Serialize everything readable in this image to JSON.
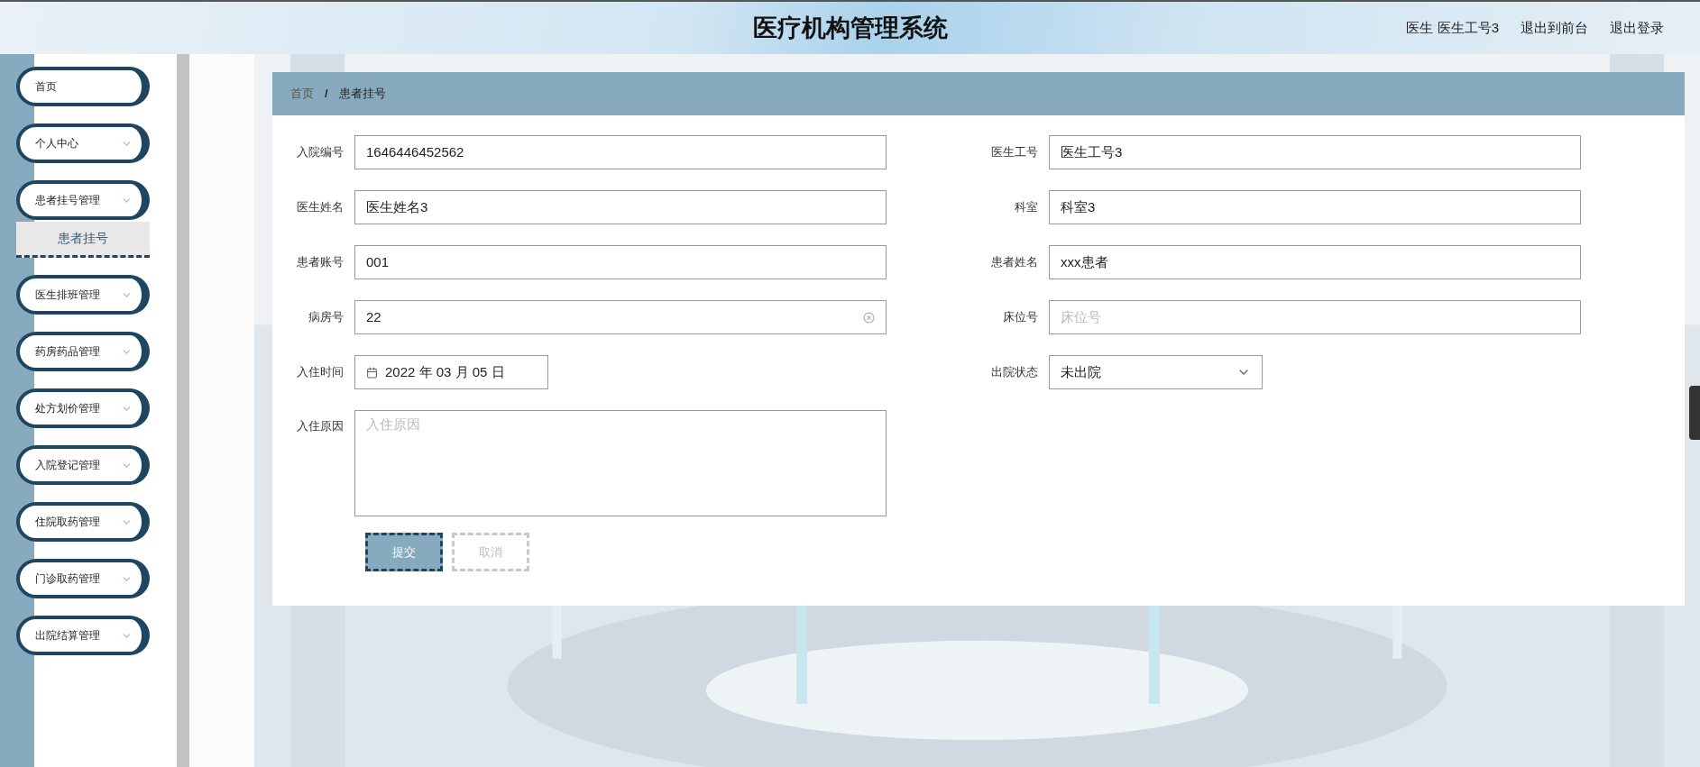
{
  "header": {
    "title": "医疗机构管理系统",
    "user": "医生 医生工号3",
    "links": [
      "退出到前台",
      "退出登录"
    ]
  },
  "sidebar": {
    "items": [
      {
        "label": "首页",
        "kind": "link"
      },
      {
        "label": "个人中心",
        "kind": "menu"
      },
      {
        "label": "患者挂号管理",
        "kind": "menu",
        "children": [
          {
            "label": "患者挂号",
            "selected": true
          }
        ]
      },
      {
        "label": "医生排班管理",
        "kind": "menu"
      },
      {
        "label": "药房药品管理",
        "kind": "menu"
      },
      {
        "label": "处方划价管理",
        "kind": "menu"
      },
      {
        "label": "入院登记管理",
        "kind": "menu"
      },
      {
        "label": "住院取药管理",
        "kind": "menu"
      },
      {
        "label": "门诊取药管理",
        "kind": "menu"
      },
      {
        "label": "出院结算管理",
        "kind": "menu"
      }
    ]
  },
  "breadcrumb": {
    "items": [
      "首页",
      "患者挂号"
    ],
    "separator": "/"
  },
  "form": {
    "fields": [
      {
        "label": "入院编号",
        "kind": "text",
        "value": "1646446452562"
      },
      {
        "label": "医生工号",
        "kind": "text",
        "value": "医生工号3"
      },
      {
        "label": "医生姓名",
        "kind": "text",
        "value": "医生姓名3"
      },
      {
        "label": "科室",
        "kind": "text",
        "value": "科室3"
      },
      {
        "label": "患者账号",
        "kind": "text",
        "value": "001"
      },
      {
        "label": "患者姓名",
        "kind": "text",
        "value": "xxx患者"
      },
      {
        "label": "病房号",
        "kind": "text",
        "value": "22",
        "clearable": true
      },
      {
        "label": "床位号",
        "kind": "text",
        "placeholder": "床位号"
      },
      {
        "label": "入住时间",
        "kind": "date",
        "value": "2022 年 03 月 05 日"
      },
      {
        "label": "出院状态",
        "kind": "select",
        "value": "未出院"
      },
      {
        "label": "入住原因",
        "kind": "textarea",
        "placeholder": "入住原因"
      }
    ],
    "buttons": [
      {
        "label": "提交",
        "kind": "primary"
      },
      {
        "label": "取消",
        "kind": "secondary"
      }
    ]
  }
}
